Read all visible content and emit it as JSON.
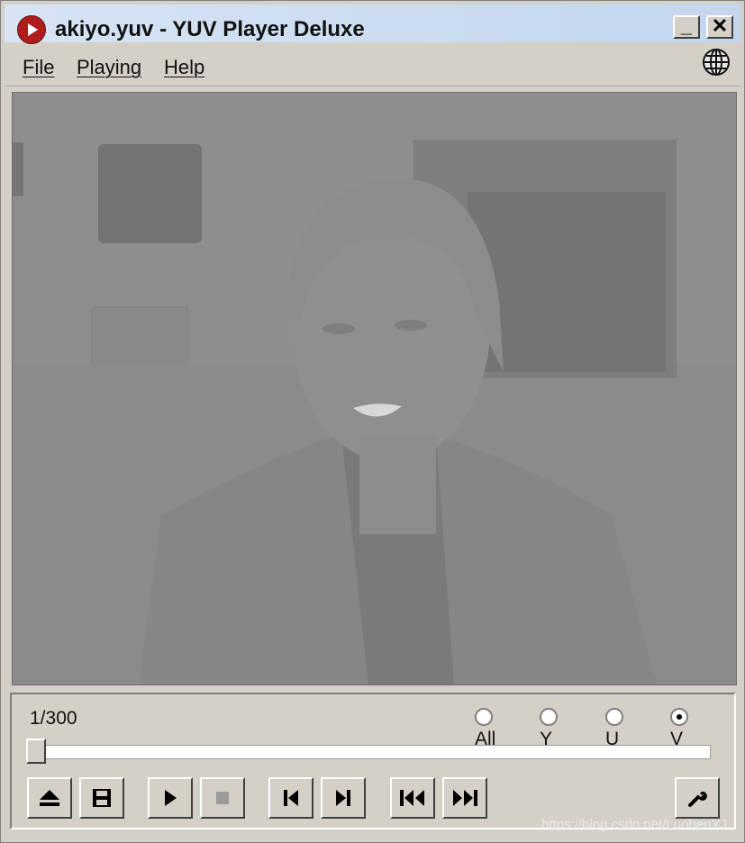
{
  "window": {
    "title": "akiyo.yuv - YUV Player Deluxe",
    "minimize_glyph": "_",
    "close_glyph": "✕"
  },
  "menu": {
    "items": [
      {
        "label": "File"
      },
      {
        "label": "Playing"
      },
      {
        "label": "Help"
      }
    ],
    "globe_icon": "globe-icon"
  },
  "video": {
    "description_icon": "video-frame"
  },
  "controls": {
    "frame_counter": "1/300",
    "channels": [
      {
        "label": "All",
        "checked": false
      },
      {
        "label": "Y",
        "checked": false
      },
      {
        "label": "U",
        "checked": false
      },
      {
        "label": "V",
        "checked": true
      }
    ],
    "progress_fraction": 0.0,
    "buttons": [
      {
        "icon": "eject-icon"
      },
      {
        "icon": "save-icon"
      },
      {
        "icon": "play-icon"
      },
      {
        "icon": "stop-icon"
      },
      {
        "icon": "step-back-icon"
      },
      {
        "icon": "step-forward-icon"
      },
      {
        "icon": "rewind-icon"
      },
      {
        "icon": "fast-forward-icon"
      },
      {
        "icon": "wrench-icon"
      }
    ]
  },
  "watermark": "https://blog.csdn.net/LuohenYJ"
}
